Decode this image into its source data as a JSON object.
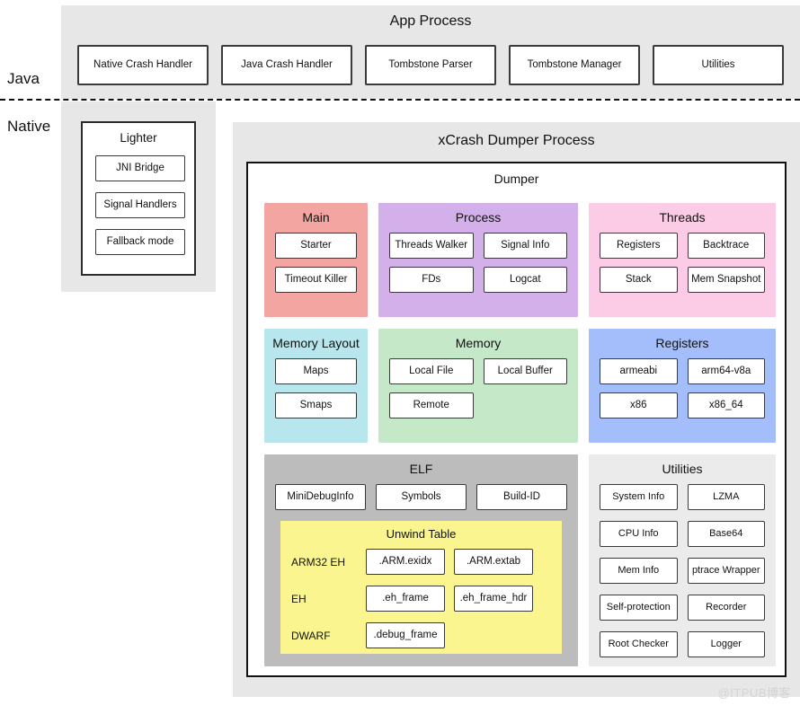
{
  "side_labels": {
    "java": "Java",
    "native": "Native"
  },
  "app_process": {
    "title": "App Process",
    "modules": [
      "Native Crash Handler",
      "Java Crash Handler",
      "Tombstone Parser",
      "Tombstone Manager",
      "Utilities"
    ]
  },
  "lighter": {
    "title": "Lighter",
    "items": [
      "JNI Bridge",
      "Signal Handlers",
      "Fallback mode"
    ]
  },
  "dumper_process": {
    "title": "xCrash Dumper Process",
    "dumper_title": "Dumper",
    "panels": {
      "main": {
        "title": "Main",
        "color": "#f3a6a1",
        "items": [
          "Starter",
          "Timeout Killer"
        ]
      },
      "process": {
        "title": "Process",
        "color": "#d4b0ea",
        "items": [
          "Threads Walker",
          "Signal Info",
          "FDs",
          "Logcat"
        ]
      },
      "threads": {
        "title": "Threads",
        "color": "#fccce7",
        "items": [
          "Registers",
          "Backtrace",
          "Stack",
          "Mem Snapshot"
        ]
      },
      "memory_layout": {
        "title": "Memory Layout",
        "color": "#b7e7ec",
        "items": [
          "Maps",
          "Smaps"
        ]
      },
      "memory": {
        "title": "Memory",
        "color": "#c4e8c8",
        "items": [
          "Local File",
          "Local Buffer",
          "Remote"
        ]
      },
      "registers": {
        "title": "Registers",
        "color": "#a4befb",
        "items": [
          "armeabi",
          "arm64-v8a",
          "x86",
          "x86_64"
        ]
      },
      "elf": {
        "title": "ELF",
        "color": "#bcbcbc",
        "top_items": [
          "MiniDebugInfo",
          "Symbols",
          "Build-ID"
        ],
        "unwind_table": {
          "title": "Unwind Table",
          "color": "#faf58e",
          "rows": [
            {
              "label": "ARM32 EH",
              "items": [
                ".ARM.exidx",
                ".ARM.extab"
              ]
            },
            {
              "label": "EH",
              "items": [
                ".eh_frame",
                ".eh_frame_hdr"
              ]
            },
            {
              "label": "DWARF",
              "items": [
                ".debug_frame"
              ]
            }
          ]
        }
      },
      "utilities": {
        "title": "Utilities",
        "color": "#ebebeb",
        "items": [
          "System Info",
          "LZMA",
          "CPU Info",
          "Base64",
          "Mem Info",
          "ptrace Wrapper",
          "Self-protection",
          "Recorder",
          "Root Checker",
          "Logger"
        ]
      }
    }
  },
  "watermark": "@ITPUB博客"
}
